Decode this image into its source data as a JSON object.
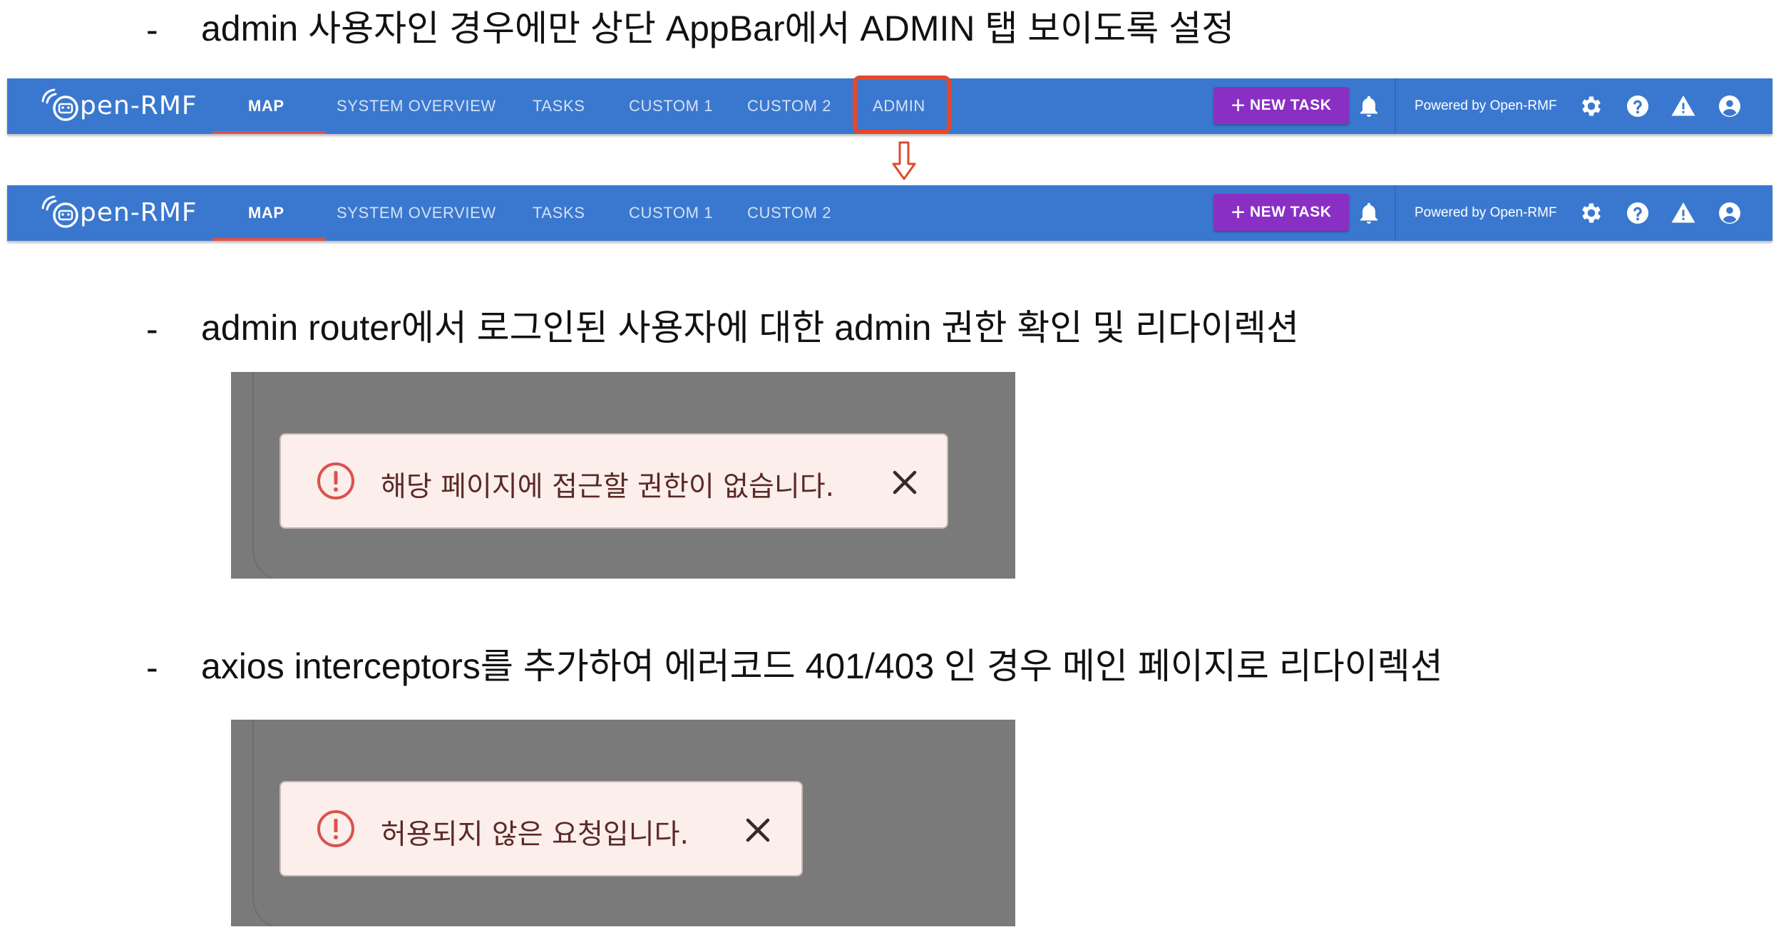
{
  "instructions": [
    {
      "bullet": "-",
      "text": "admin 사용자인 경우에만 상단 AppBar에서 ADMIN 탭 보이도록 설정"
    },
    {
      "bullet": "-",
      "text": "admin router에서 로그인된 사용자에 대한 admin 권한 확인 및 리다이렉션"
    },
    {
      "bullet": "-",
      "text": "axios interceptors를 추가하여 에러코드 401/403 인 경우 메인 페이지로 리다이렉션"
    }
  ],
  "appbar_before": {
    "logo": "pen-RMF",
    "tabs": [
      "MAP",
      "SYSTEM OVERVIEW",
      "TASKS",
      "CUSTOM 1",
      "CUSTOM 2",
      "ADMIN"
    ],
    "active_tab": "MAP",
    "new_task_label": "NEW TASK",
    "powered_by": "Powered by Open-RMF"
  },
  "appbar_after": {
    "logo": "pen-RMF",
    "tabs": [
      "MAP",
      "SYSTEM OVERVIEW",
      "TASKS",
      "CUSTOM 1",
      "CUSTOM 2"
    ],
    "active_tab": "MAP",
    "new_task_label": "NEW TASK",
    "powered_by": "Powered by Open-RMF"
  },
  "alerts": [
    {
      "message": "해당 페이지에 접근할 권한이 없습니다.",
      "severity": "error"
    },
    {
      "message": "허용되지 않은 요청입니다.",
      "severity": "error"
    }
  ],
  "colors": {
    "appbar": "#3a78cf",
    "new_task_button": "#8a2fc4",
    "highlight": "#e04a2c",
    "active_tab_indicator": "#d9534f",
    "alert_background": "#fbeeeb",
    "alert_icon": "#d9534f"
  },
  "icons": [
    "logo-robot-icon",
    "plus-icon",
    "bell-icon",
    "gear-icon",
    "help-icon",
    "warning-icon",
    "account-icon",
    "down-arrow-icon",
    "error-icon",
    "close-icon"
  ]
}
